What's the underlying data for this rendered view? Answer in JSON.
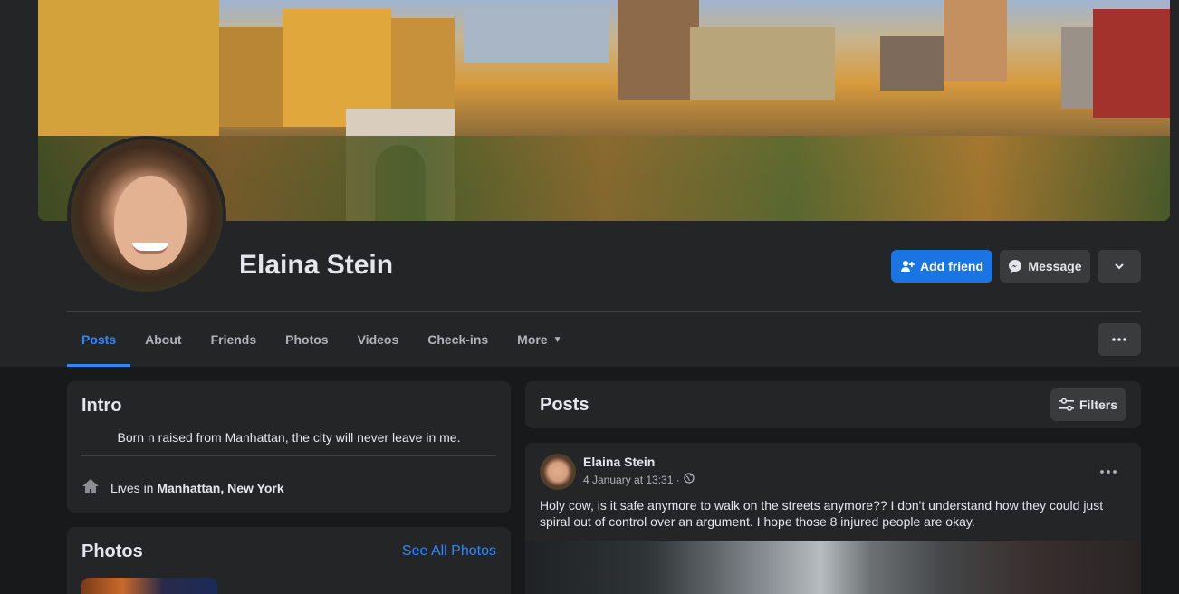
{
  "profile": {
    "name": "Elaina Stein",
    "actions": {
      "add_friend": "Add friend",
      "message": "Message"
    }
  },
  "tabs": [
    {
      "label": "Posts",
      "active": true
    },
    {
      "label": "About"
    },
    {
      "label": "Friends"
    },
    {
      "label": "Photos"
    },
    {
      "label": "Videos"
    },
    {
      "label": "Check-ins"
    },
    {
      "label": "More"
    }
  ],
  "intro": {
    "title": "Intro",
    "bio": "Born n raised from Manhattan, the city will never leave in me.",
    "lives_prefix": "Lives in",
    "lives_place": "Manhattan, New York"
  },
  "photos": {
    "title": "Photos",
    "see_all": "See All Photos"
  },
  "posts_header": {
    "title": "Posts",
    "filters": "Filters"
  },
  "post": {
    "author": "Elaina Stein",
    "timestamp": "4 January at 13:31 ·",
    "text": "Holy cow, is it safe anymore to walk on the streets anymore?? I don't understand how they could just spiral out of control over an argument. I hope those 8 injured people are okay."
  },
  "colors": {
    "accent": "#2d88ff",
    "primary_button": "#1b74e4",
    "background": "#18191a",
    "card": "#242526"
  },
  "icons": [
    "add-person-icon",
    "messenger-icon",
    "chevron-down-icon",
    "more-horizontal-icon",
    "home-icon",
    "filters-icon",
    "globe-icon"
  ]
}
